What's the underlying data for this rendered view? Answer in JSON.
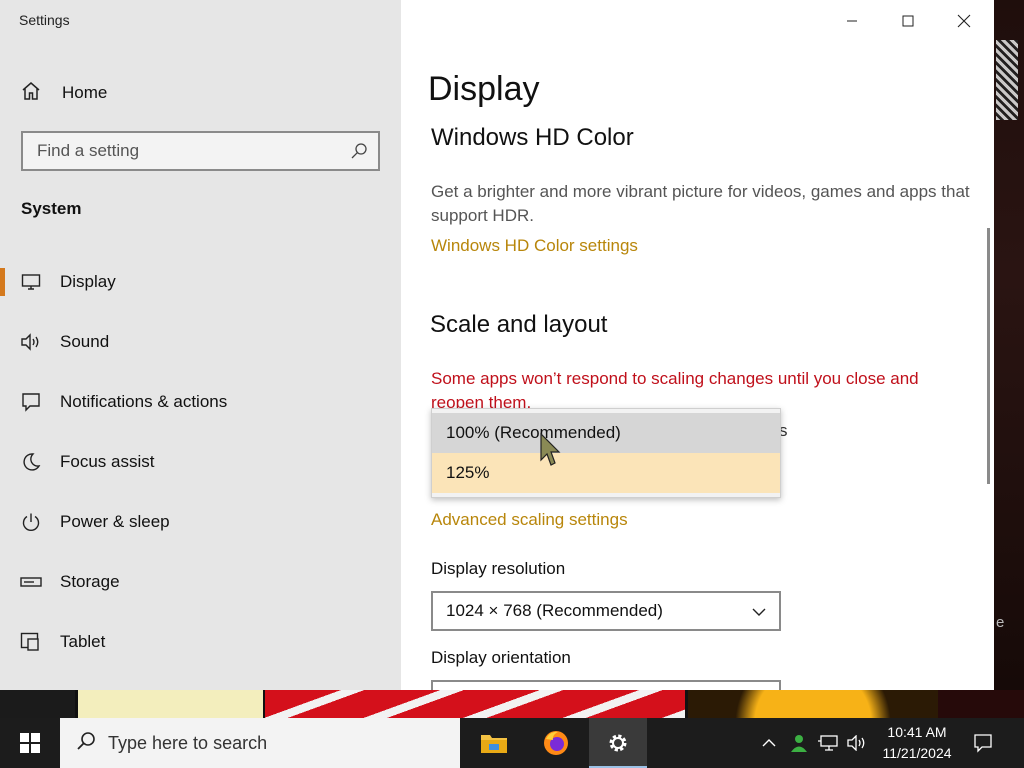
{
  "window": {
    "title": "Settings",
    "controls": {
      "minimize": "minimize",
      "maximize": "maximize",
      "close": "close"
    }
  },
  "sidebar": {
    "home_label": "Home",
    "search_placeholder": "Find a setting",
    "section_title": "System",
    "items": [
      {
        "label": "Display",
        "icon": "monitor-icon",
        "active": true
      },
      {
        "label": "Sound",
        "icon": "speaker-icon",
        "active": false
      },
      {
        "label": "Notifications & actions",
        "icon": "notification-icon",
        "active": false
      },
      {
        "label": "Focus assist",
        "icon": "moon-icon",
        "active": false
      },
      {
        "label": "Power & sleep",
        "icon": "power-icon",
        "active": false
      },
      {
        "label": "Storage",
        "icon": "storage-icon",
        "active": false
      },
      {
        "label": "Tablet",
        "icon": "tablet-icon",
        "active": false
      }
    ]
  },
  "main": {
    "page_title": "Display",
    "hd_color": {
      "heading": "Windows HD Color",
      "description": "Get a brighter and more vibrant picture for videos, games and apps that support HDR.",
      "link": "Windows HD Color settings"
    },
    "scale": {
      "heading": "Scale and layout",
      "warning": "Some apps won’t respond to scaling changes until you close and reopen them.",
      "partial_label": "s",
      "options": [
        "100% (Recommended)",
        "125%"
      ],
      "advanced_link": "Advanced scaling settings"
    },
    "resolution": {
      "label": "Display resolution",
      "value": "1024 × 768 (Recommended)"
    },
    "orientation": {
      "label": "Display orientation"
    }
  },
  "desktop": {
    "edge_letter": "e"
  },
  "taskbar": {
    "search_placeholder": "Type here to search",
    "apps": [
      "file-explorer-icon",
      "firefox-icon",
      "settings-gear-icon"
    ],
    "time": "10:41 AM",
    "date": "11/21/2024"
  },
  "colors": {
    "accent": "#d4791d",
    "link": "#b8860b",
    "warning": "#c0101b",
    "sidebar_bg": "#e6e6e6",
    "option_highlight": "#fbe4b8"
  }
}
